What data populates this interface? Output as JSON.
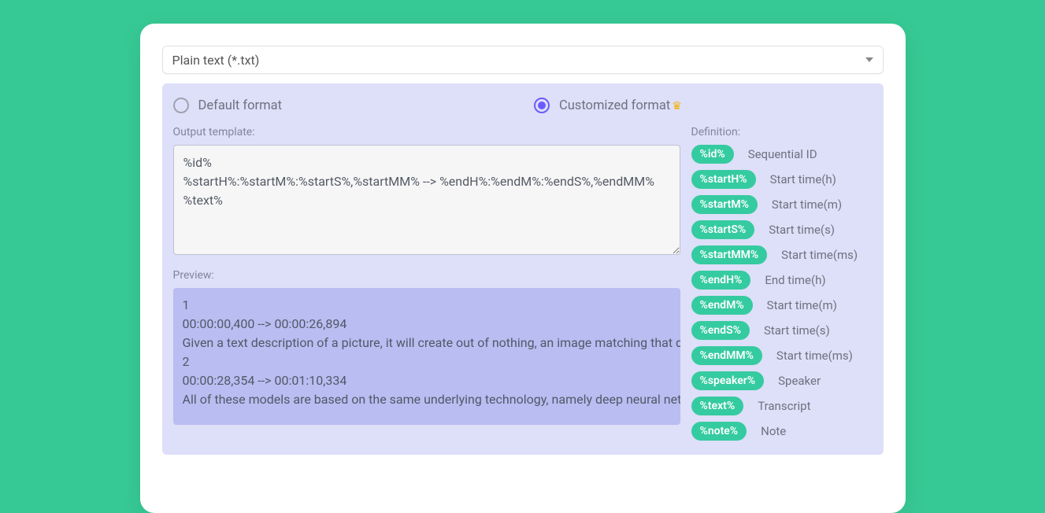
{
  "select": {
    "value": "Plain text (*.txt)"
  },
  "formatOptions": {
    "default": "Default format",
    "customized": "Customized format"
  },
  "labels": {
    "outputTemplate": "Output template:",
    "preview": "Preview:",
    "definition": "Definition:"
  },
  "templateValue": "%id%\n%startH%:%startM%:%startS%,%startMM% --> %endH%:%endM%:%endS%,%endMM%\n%text%",
  "previewText": "1\n00:00:00,400 --> 00:00:26,894\nGiven a text description of a picture, it will create out of nothing, an image matching that description.\n2\n00:00:28,354 --> 00:01:10,334\nAll of these models are based on the same underlying technology, namely deep neural networks.",
  "definitions": [
    {
      "token": "%id%",
      "desc": "Sequential ID"
    },
    {
      "token": "%startH%",
      "desc": "Start time(h)"
    },
    {
      "token": "%startM%",
      "desc": "Start time(m)"
    },
    {
      "token": "%startS%",
      "desc": "Start time(s)"
    },
    {
      "token": "%startMM%",
      "desc": "Start time(ms)"
    },
    {
      "token": "%endH%",
      "desc": "End time(h)"
    },
    {
      "token": "%endM%",
      "desc": "Start time(m)"
    },
    {
      "token": "%endS%",
      "desc": "Start time(s)"
    },
    {
      "token": "%endMM%",
      "desc": "Start time(ms)"
    },
    {
      "token": "%speaker%",
      "desc": "Speaker"
    },
    {
      "token": "%text%",
      "desc": "Transcript"
    },
    {
      "token": "%note%",
      "desc": "Note"
    }
  ]
}
